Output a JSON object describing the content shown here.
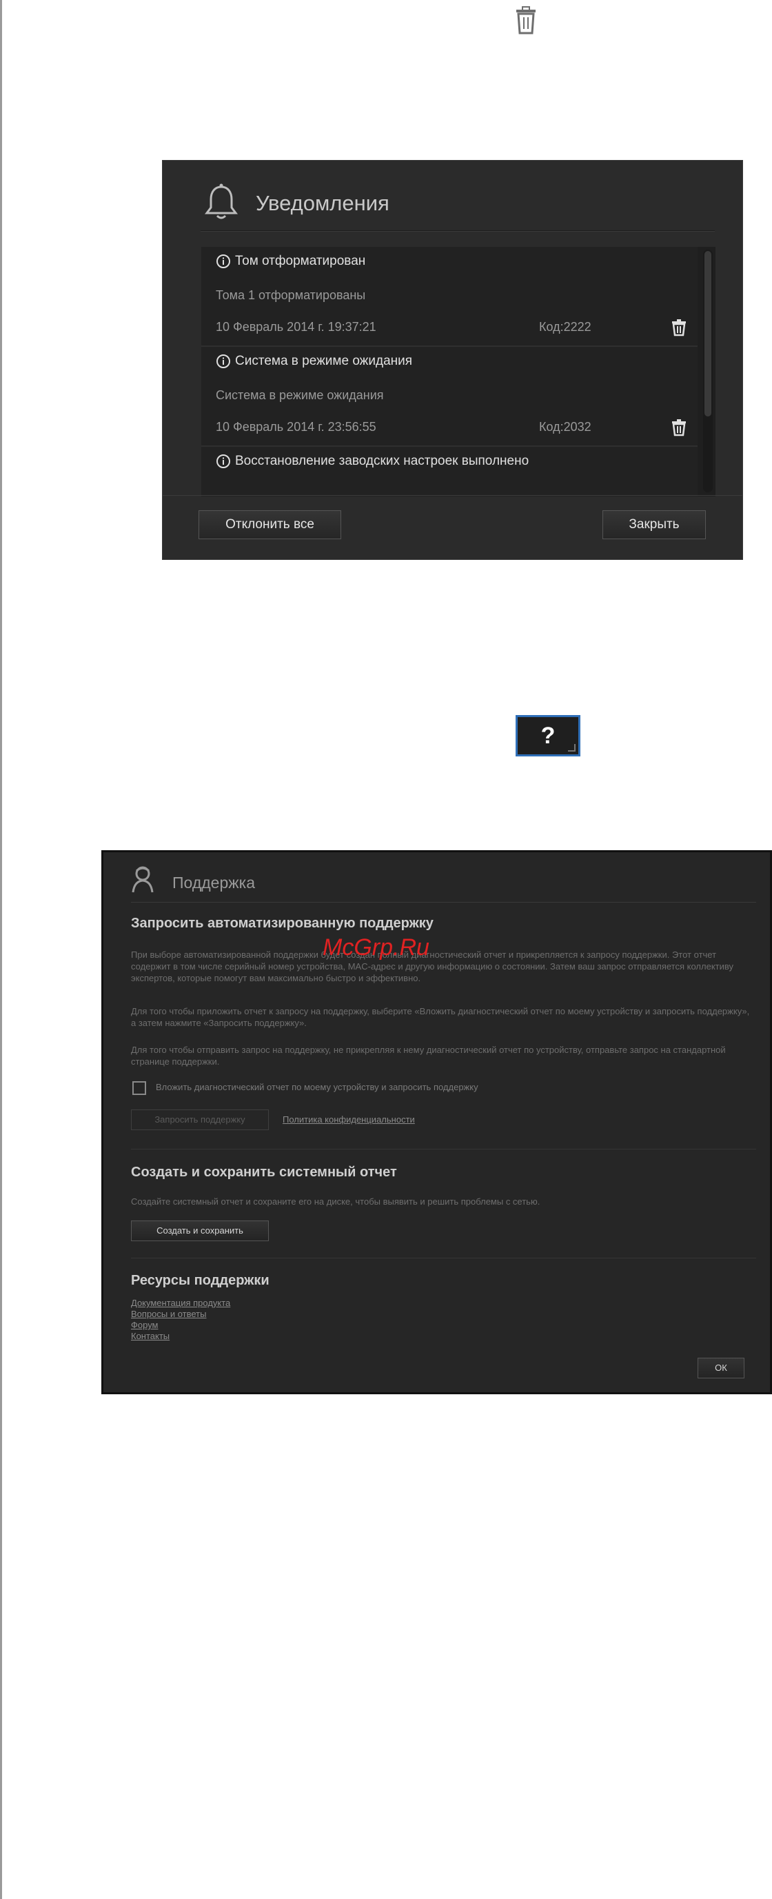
{
  "notifications": {
    "title": "Уведомления",
    "items": [
      {
        "title": "Том отформатирован",
        "description": "Тома 1 отформатированы",
        "date": "10 Февраль 2014 г. 19:37:21",
        "code": "Код:2222"
      },
      {
        "title": "Система в режиме ожидания",
        "description": "Система в режиме ожидания",
        "date": "10 Февраль 2014 г. 23:56:55",
        "code": "Код:2032"
      },
      {
        "title": "Восстановление заводских настроек выполнено",
        "description": "",
        "date": "",
        "code": ""
      }
    ],
    "dismiss_all_label": "Отклонить все",
    "close_label": "Закрыть"
  },
  "help_button": {
    "label": "?"
  },
  "support": {
    "title": "Поддержка",
    "auto": {
      "heading": "Запросить автоматизированную поддержку",
      "para1": "При выборе автоматизированной поддержки будет создан полный диагностический отчет и прикрепляется к запросу поддержки. Этот отчет содержит в том числе серийный номер устройства, MAC-адрес и другую информацию о состоянии. Затем ваш запрос отправляется коллективу экспертов, которые помогут вам максимально быстро и эффективно.",
      "para2": "Для того чтобы приложить отчет к запросу на поддержку, выберите «Вложить диагностический отчет по моему устройству и запросить поддержку», а затем нажмите «Запросить поддержку».",
      "para3": "Для того чтобы отправить запрос на поддержку, не прикрепляя к нему диагностический отчет по устройству, отправьте запрос на стандартной странице поддержки.",
      "checkbox_label": "Вложить диагностический отчет по моему устройству и запросить поддержку",
      "request_button": "Запросить поддержку",
      "privacy_link": "Политика конфиденциальности"
    },
    "report": {
      "heading": "Создать и сохранить системный отчет",
      "text": "Создайте системный отчет и сохраните его на диске, чтобы выявить и решить проблемы с сетью.",
      "button": "Создать и сохранить"
    },
    "resources": {
      "heading": "Ресурсы поддержки",
      "links": [
        "Документация продукта",
        "Вопросы и ответы",
        "Форум",
        "Контакты"
      ]
    },
    "ok_label": "ОК"
  },
  "watermark": "McGrp.Ru"
}
